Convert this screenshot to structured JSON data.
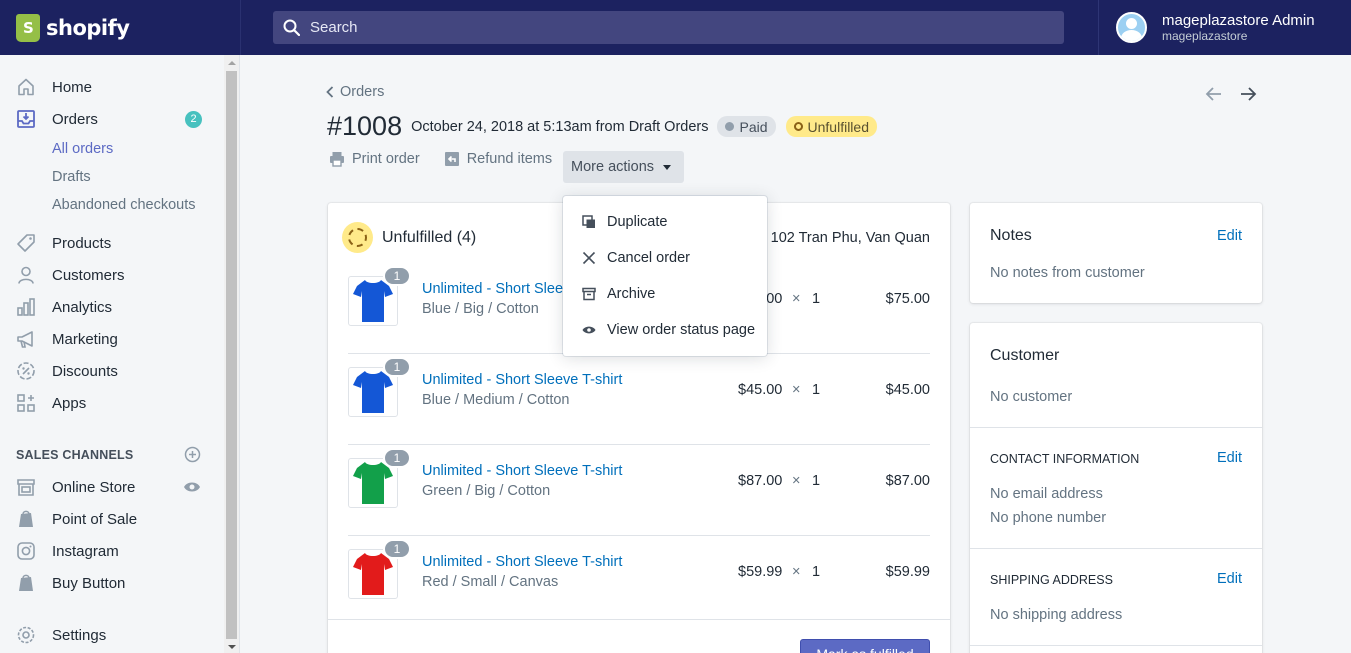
{
  "brand": {
    "name": "shopify",
    "accent": "#5c6ac4",
    "topbar": "#1c2260"
  },
  "search": {
    "placeholder": "Search"
  },
  "user": {
    "name": "mageplazastore Admin",
    "store": "mageplazastore"
  },
  "sidebar": {
    "items": [
      {
        "label": "Home",
        "icon": "home-icon"
      },
      {
        "label": "Orders",
        "icon": "orders-icon",
        "badge": "2"
      },
      {
        "label": "Products",
        "icon": "tag-icon"
      },
      {
        "label": "Customers",
        "icon": "person-icon"
      },
      {
        "label": "Analytics",
        "icon": "bar-chart-icon"
      },
      {
        "label": "Marketing",
        "icon": "megaphone-icon"
      },
      {
        "label": "Discounts",
        "icon": "discount-icon"
      },
      {
        "label": "Apps",
        "icon": "apps-icon"
      }
    ],
    "orders_sub": [
      "All orders",
      "Drafts",
      "Abandoned checkouts"
    ],
    "sales_channels_heading": "SALES CHANNELS",
    "channels": [
      {
        "label": "Online Store",
        "icon": "store-icon"
      },
      {
        "label": "Point of Sale",
        "icon": "shopify-bag-icon"
      },
      {
        "label": "Instagram",
        "icon": "instagram-icon"
      },
      {
        "label": "Buy Button",
        "icon": "shopify-bag-icon"
      }
    ],
    "settings": "Settings"
  },
  "breadcrumb": "Orders",
  "order": {
    "number": "#1008",
    "meta": "October 24, 2018 at 5:13am from Draft Orders",
    "payment_status": "Paid",
    "fulfillment_status": "Unfulfilled"
  },
  "actions": {
    "print": "Print order",
    "refund": "Refund items",
    "more": "More actions"
  },
  "more_menu": [
    "Duplicate",
    "Cancel order",
    "Archive",
    "View order status page"
  ],
  "unfulfilled": {
    "title": "Unfulfilled (4)",
    "location": "102 Tran Phu, Van Quan",
    "button": "Mark as fulfilled"
  },
  "line_items": [
    {
      "name": "Unlimited - Short Sleeve T-shirt",
      "variant": "Blue / Big / Cotton",
      "price": "$75.00",
      "x": "×",
      "qty": "1",
      "total": "$75.00",
      "badge": "1",
      "color": "#1457d6"
    },
    {
      "name": "Unlimited - Short Sleeve T-shirt",
      "variant": "Blue / Medium / Cotton",
      "price": "$45.00",
      "x": "×",
      "qty": "1",
      "total": "$45.00",
      "badge": "1",
      "color": "#1457d6"
    },
    {
      "name": "Unlimited - Short Sleeve T-shirt",
      "variant": "Green / Big / Cotton",
      "price": "$87.00",
      "x": "×",
      "qty": "1",
      "total": "$87.00",
      "badge": "1",
      "color": "#12a04a"
    },
    {
      "name": "Unlimited - Short Sleeve T-shirt",
      "variant": "Red / Small / Canvas",
      "price": "$59.99",
      "x": "×",
      "qty": "1",
      "total": "$59.99",
      "badge": "1",
      "color": "#e21b1b"
    }
  ],
  "notes": {
    "title": "Notes",
    "edit": "Edit",
    "text": "No notes from customer"
  },
  "customer": {
    "title": "Customer",
    "text": "No customer",
    "contact_heading": "CONTACT INFORMATION",
    "contact_edit": "Edit",
    "email": "No email address",
    "phone": "No phone number",
    "shipping_heading": "SHIPPING ADDRESS",
    "shipping_edit": "Edit",
    "shipping": "No shipping address"
  }
}
